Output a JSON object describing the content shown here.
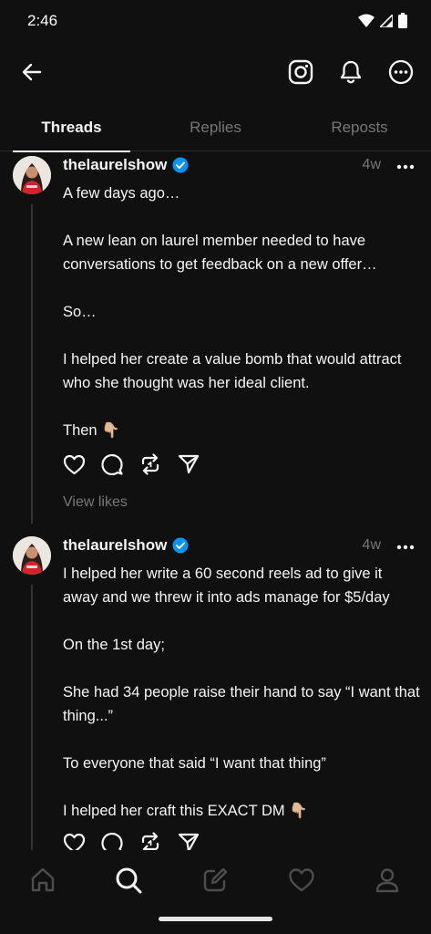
{
  "status": {
    "time": "2:46"
  },
  "tabs": [
    {
      "label": "Threads",
      "active": true
    },
    {
      "label": "Replies",
      "active": false
    },
    {
      "label": "Reposts",
      "active": false
    }
  ],
  "posts": [
    {
      "username": "thelaurelshow",
      "verified": true,
      "time": "4w",
      "text": "A few days ago…\n\nA new lean on laurel member needed to have conversations to get feedback on a new offer…\n\nSo…\n\nI helped her create a value bomb that would attract who she thought was her ideal client.\n\nThen 👇🏼",
      "view_likes": "View likes"
    },
    {
      "username": "thelaurelshow",
      "verified": true,
      "time": "4w",
      "text": "I helped her write a 60 second reels ad to give it away and we threw it into ads manage for $5/day\n\nOn the 1st day;\n\nShe had 34 people raise their hand to say “I want that thing...”\n\nTo everyone that said “I want that thing”\n\nI helped her craft this EXACT DM 👇🏼"
    }
  ],
  "icons": {
    "back": "back-arrow-icon",
    "instagram": "instagram-icon",
    "notifications": "bell-icon",
    "more": "more-icon",
    "verified": "verified-badge-icon",
    "like": "heart-icon",
    "reply": "comment-icon",
    "repost": "repost-icon",
    "share": "send-icon",
    "nav_home": "home-icon",
    "nav_search": "search-icon",
    "nav_compose": "compose-icon",
    "nav_activity": "heart-icon",
    "nav_profile": "profile-icon"
  },
  "colors": {
    "background": "#101010",
    "text": "#f3f5f7",
    "muted": "#777777",
    "verified": "#0095f6"
  }
}
